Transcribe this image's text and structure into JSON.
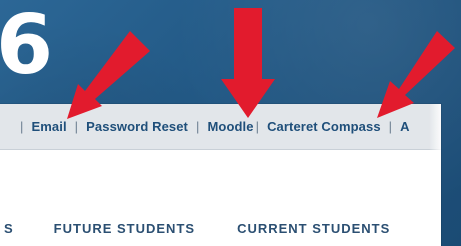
{
  "overlay": {
    "number": "6"
  },
  "links_bar": {
    "separator_leading": "|",
    "email": "Email",
    "separator_1": "|",
    "password_reset": "Password Reset",
    "separator_2": "|",
    "moodle": "Moodle",
    "separator_3": "|",
    "carteret_compass": "Carteret Compass",
    "separator_4": "|",
    "trailing_fragment": "A"
  },
  "nav": {
    "partial_first": "S",
    "future_students": "FUTURE STUDENTS",
    "current_students": "CURRENT STUDENTS"
  },
  "icons": {
    "arrow_1": "red-arrow-icon",
    "arrow_2": "red-arrow-icon",
    "arrow_3": "red-arrow-icon"
  },
  "colors": {
    "background": "#245a86",
    "arrow": "#e21b2d",
    "link_text": "#1f4f7a"
  }
}
